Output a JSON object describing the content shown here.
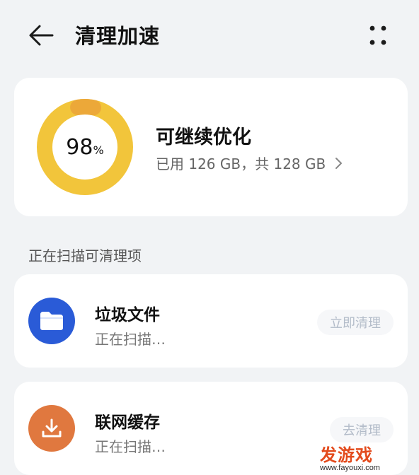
{
  "header": {
    "title": "清理加速",
    "back_icon": "arrow-left-icon",
    "more_icon": "more-dots-icon"
  },
  "storage": {
    "percent": 98,
    "percent_number": "98",
    "percent_sign": "%",
    "status": "可继续优化",
    "usage": "已用 126 GB，共 128 GB",
    "ring_color": "#f2c53b",
    "ring_head_color": "#eca839"
  },
  "scan": {
    "section_label": "正在扫描可清理项",
    "items": [
      {
        "name": "垃圾文件",
        "state": "正在扫描…",
        "action": "立即清理",
        "icon": "folder-icon",
        "icon_color": "#2a5bd7"
      },
      {
        "name": "联网缓存",
        "state": "正在扫描…",
        "action": "去清理",
        "icon": "download-icon",
        "icon_color": "#e0783f"
      }
    ]
  },
  "watermark": {
    "brand": "发游戏",
    "url": "www.fayouxi.com"
  }
}
